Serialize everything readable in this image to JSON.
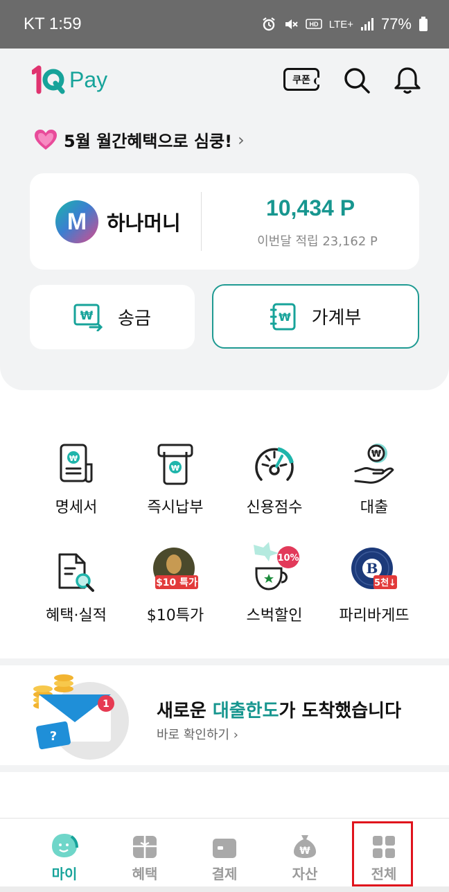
{
  "status_bar": {
    "carrier_time": "KT 1:59",
    "network": "LTE+",
    "battery": "77%"
  },
  "header": {
    "logo_prefix": "1Q",
    "logo_text": "Pay",
    "coupon_label": "쿠폰"
  },
  "promo": {
    "text": "5월 월간혜택으로 심쿵!",
    "chevron": "›"
  },
  "hana_money": {
    "name": "하나머니",
    "logo_letter": "M",
    "points": "10,434 P",
    "monthly_earned": "이번달 적립 23,162 P"
  },
  "quick_actions": {
    "send_label": "송금",
    "ledger_label": "가계부"
  },
  "menu": {
    "items": [
      {
        "label": "명세서"
      },
      {
        "label": "즉시납부"
      },
      {
        "label": "신용점수"
      },
      {
        "label": "대출"
      },
      {
        "label": "혜택·실적"
      },
      {
        "label": "$10특가",
        "badge": "$10 특가"
      },
      {
        "label": "스벅할인",
        "badge": "10%"
      },
      {
        "label": "파리바게뜨",
        "badge": "5천↓",
        "logo_letter": "B"
      }
    ]
  },
  "banner": {
    "title_before": "새로운 ",
    "title_highlight": "대출한도",
    "title_after": "가 도착했습니다",
    "link": "바로 확인하기 ›",
    "notification_count": "1"
  },
  "tabbar": {
    "tabs": [
      {
        "label": "마이",
        "active": true
      },
      {
        "label": "혜택"
      },
      {
        "label": "결제"
      },
      {
        "label": "자산"
      },
      {
        "label": "전체"
      }
    ]
  },
  "colors": {
    "accent": "#17a39a",
    "highlight_box": "#e0131c"
  }
}
